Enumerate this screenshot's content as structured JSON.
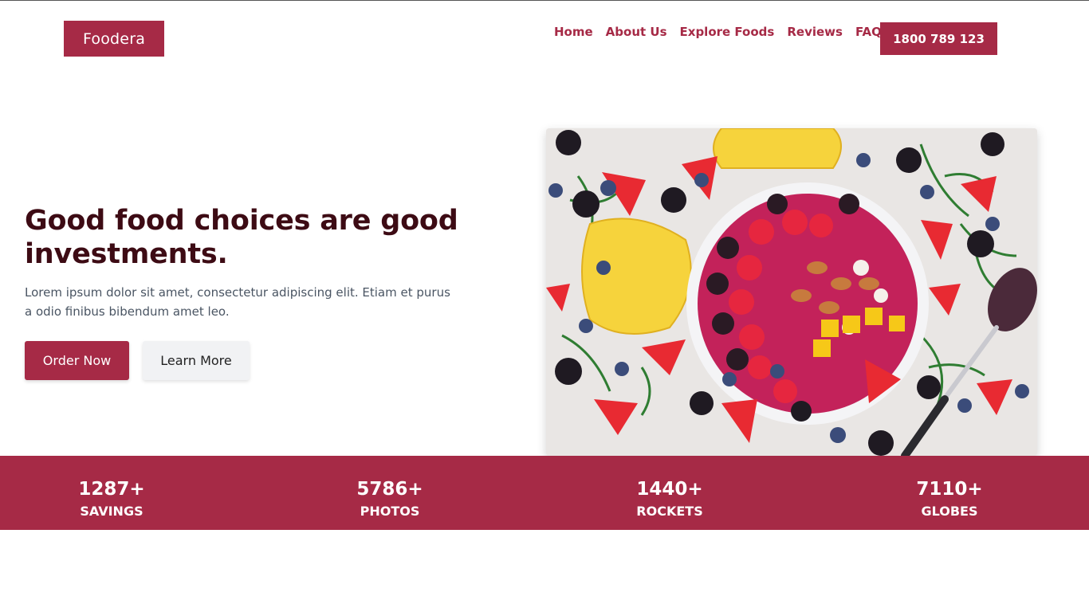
{
  "brand": {
    "name": "Foodera",
    "accent": "#a62a46",
    "heading_color": "#3d0b14"
  },
  "nav": {
    "items": [
      {
        "label": "Home"
      },
      {
        "label": "About Us"
      },
      {
        "label": "Explore Foods"
      },
      {
        "label": "Reviews"
      },
      {
        "label": "FAQ"
      }
    ],
    "phone": "1800 789 123"
  },
  "hero": {
    "headline": "Good food choices are good investments.",
    "body": "Lorem ipsum dolor sit amet, consectetur adipiscing elit. Etiam et purus a odio finibus bibendum amet leo.",
    "primary_cta": "Order Now",
    "secondary_cta": "Learn More",
    "image_icon": "fruit-bowl-photo"
  },
  "stats": [
    {
      "value": "1287+",
      "label": "SAVINGS"
    },
    {
      "value": "5786+",
      "label": "PHOTOS"
    },
    {
      "value": "1440+",
      "label": "ROCKETS"
    },
    {
      "value": "7110+",
      "label": "GLOBES"
    }
  ]
}
